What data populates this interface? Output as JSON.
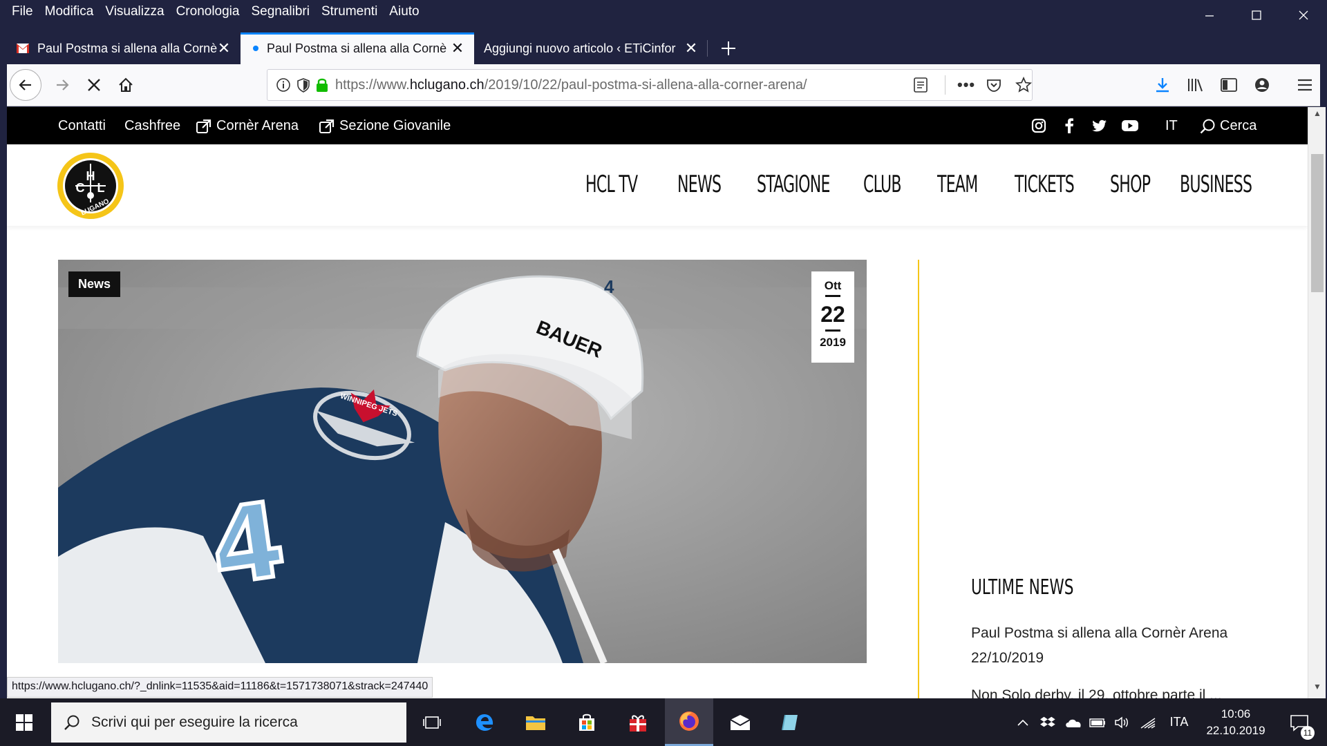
{
  "menubar": {
    "items": [
      "File",
      "Modifica",
      "Visualizza",
      "Cronologia",
      "Segnalibri",
      "Strumenti",
      "Aiuto"
    ]
  },
  "tabs": [
    {
      "label": "Paul Postma si allena alla Cornè",
      "icon": "gmail-icon"
    },
    {
      "label": "Paul Postma si allena alla Cornè",
      "icon": "loading-dot-icon"
    },
    {
      "label": "Aggiungi nuovo articolo ‹ ETiCinfor",
      "icon": "none"
    }
  ],
  "urlbar": {
    "prefix": "https://www.",
    "domain": "hclugano.ch",
    "path": "/2019/10/22/paul-postma-si-allena-alla-corner-arena/"
  },
  "site": {
    "top_links": [
      "Contatti",
      "Cashfree",
      "Cornèr Arena",
      "Sezione Giovanile"
    ],
    "language": "IT",
    "search_label": "Cerca",
    "logo_letters": [
      "H",
      "C",
      "L"
    ],
    "logo_text": "LUGANO",
    "nav": [
      "HCL TV",
      "NEWS",
      "STAGIONE",
      "CLUB",
      "TEAM",
      "TICKETS",
      "SHOP",
      "BUSINESS"
    ],
    "article": {
      "category": "News",
      "date_month": "Ott",
      "date_day": "22",
      "date_year": "2019",
      "jersey_number": "4",
      "helmet_brand": "BAUER",
      "crest_text": "WINNIPEG JETS"
    },
    "sidebar": {
      "title": "ULTIME NEWS",
      "item1_title": "Paul Postma si allena alla Cornèr Arena",
      "item1_date": "22/10/2019",
      "item2_title": "Non Solo derby, il 29, ottobre parte il ..."
    },
    "accent_color": "#f5c518"
  },
  "status_url": "https://www.hclugano.ch/?_dnlink=11535&aid=11186&t=1571738071&strack=247440",
  "taskbar": {
    "search_placeholder": "Scrivi qui per eseguire la ricerca",
    "language": "ITA",
    "time": "10:06",
    "date": "22.10.2019",
    "notifications": "11"
  }
}
